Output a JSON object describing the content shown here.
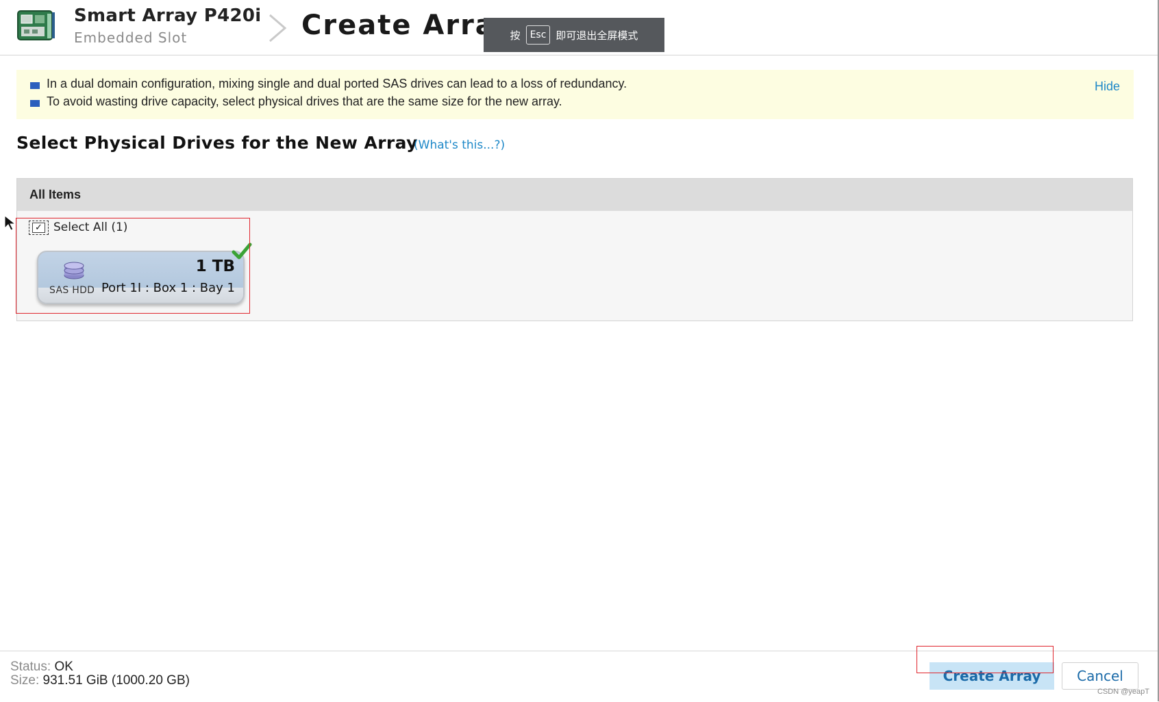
{
  "header": {
    "controller_name": "Smart Array P420i",
    "controller_slot": "Embedded Slot",
    "page_title": "Create Array"
  },
  "fullscreen_toast": {
    "prefix": "按",
    "key": "Esc",
    "suffix": "即可退出全屏模式"
  },
  "notice": {
    "lines": [
      "In a dual domain configuration, mixing single and dual ported SAS drives can lead to a loss of redundancy.",
      "To avoid wasting drive capacity, select physical drives that are the same size for the new array."
    ],
    "hide_label": "Hide"
  },
  "section": {
    "title": "Select Physical Drives for the New Array",
    "help_link": "(What's this...?)"
  },
  "panel": {
    "header": "All Items",
    "select_all_label": "Select All (1)",
    "select_all_checked": true,
    "drives": [
      {
        "type": "SAS HDD",
        "size": "1 TB",
        "location": "Port 1I : Box 1 : Bay 1",
        "selected": true
      }
    ]
  },
  "footer": {
    "status_label": "Status:",
    "status_value": "OK",
    "size_label": "Size:",
    "size_value": "931.51 GiB (1000.20 GB)",
    "create_button": "Create Array",
    "cancel_button": "Cancel"
  },
  "watermark": "CSDN @yeapT",
  "colors": {
    "accent_link": "#1e88c8",
    "notice_bg": "#fdfde1",
    "annotation_red": "#e0262e",
    "button_primary_bg": "#c8e4f6",
    "check_green": "#3aa335"
  },
  "icons": {
    "controller": "raid-controller-icon",
    "breadcrumb": "chevron-right-icon",
    "drive": "disk-stack-icon",
    "selected": "checkmark-icon",
    "cursor": "mouse-pointer-icon"
  }
}
